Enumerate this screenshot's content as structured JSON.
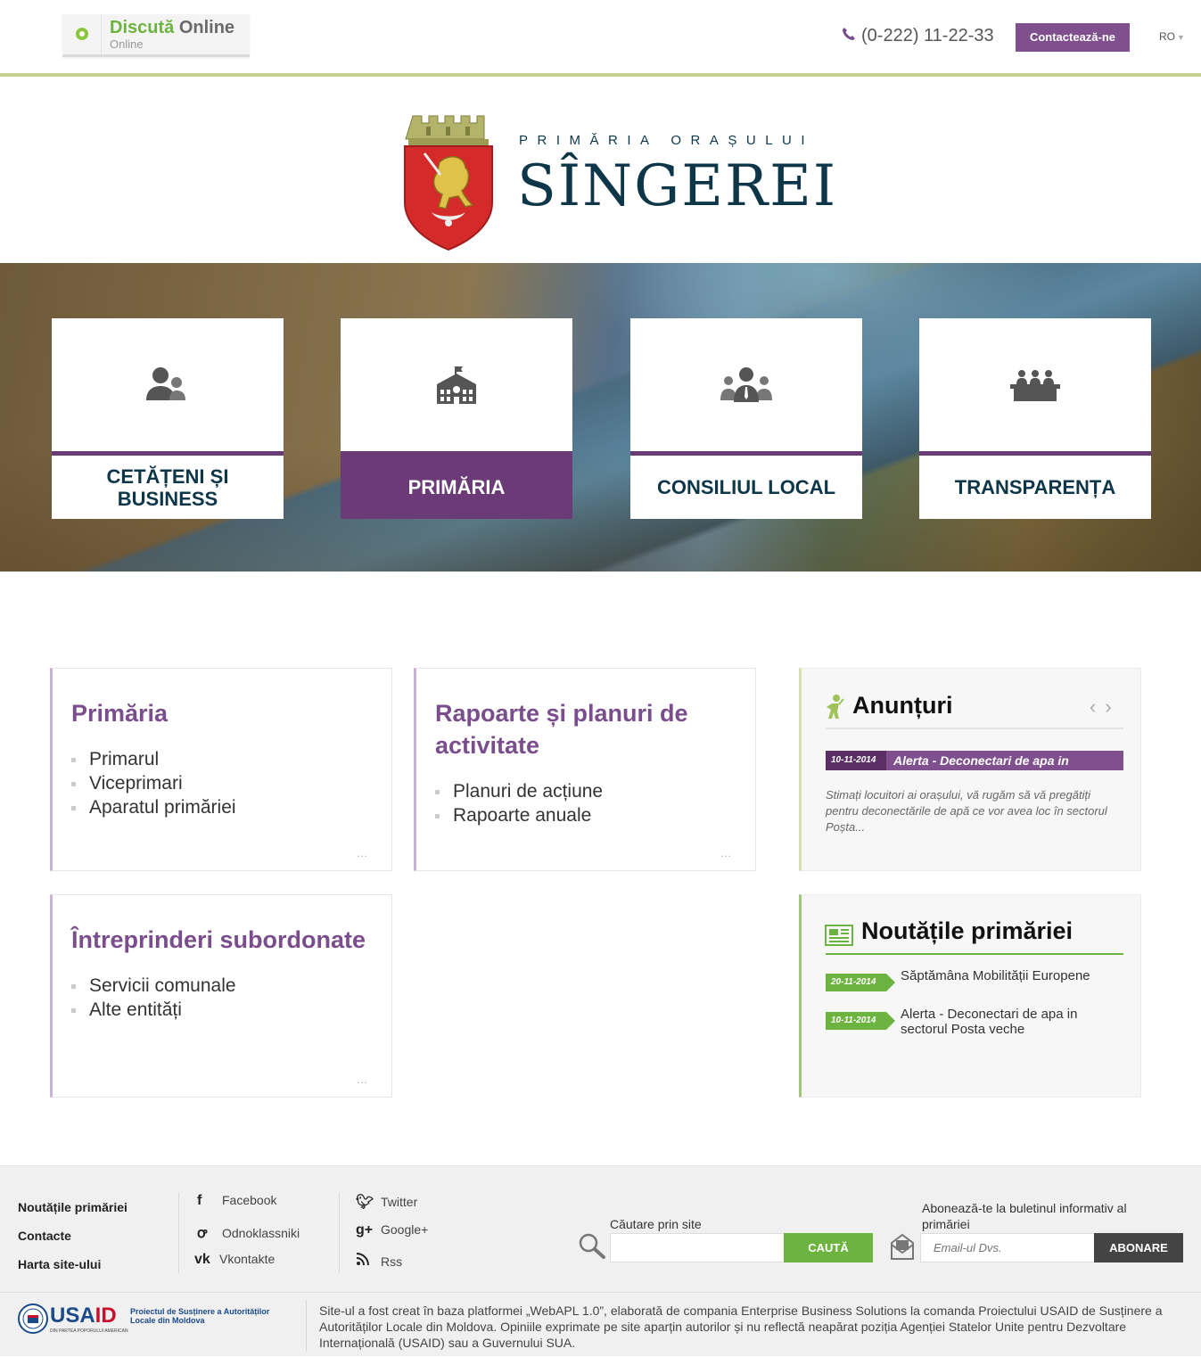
{
  "header": {
    "chat_title_green": "Discută",
    "chat_title_rest": "Online",
    "chat_status": "Online",
    "phone": "(0-222) 11-22-33",
    "contact_button": "Contactează-ne",
    "language": "RO"
  },
  "logo": {
    "subtitle": "PRIMĂRIA ORAȘULUI",
    "title": "SÎNGEREI"
  },
  "hero_tiles": [
    {
      "label": "CETĂȚENI ȘI BUSINESS",
      "icon": "citizens-icon",
      "active": false
    },
    {
      "label": "PRIMĂRIA",
      "icon": "city-hall-icon",
      "active": true
    },
    {
      "label": "CONSILIUL LOCAL",
      "icon": "council-icon",
      "active": false
    },
    {
      "label": "TRANSPARENȚA",
      "icon": "meeting-table-icon",
      "active": false
    }
  ],
  "cards": {
    "primaria": {
      "title": "Primăria",
      "items": [
        "Primarul",
        "Viceprimari",
        "Aparatul primăriei"
      ],
      "more": "..."
    },
    "rapoarte": {
      "title": "Rapoarte și planuri de activitate",
      "items": [
        "Planuri de acțiune",
        "Rapoarte anuale"
      ],
      "more": "..."
    },
    "intreprinderi": {
      "title": "Întreprinderi subordonate",
      "items": [
        "Servicii comunale",
        "Alte entități"
      ],
      "more": "..."
    }
  },
  "announcements": {
    "title": "Anunțuri",
    "prev": "‹",
    "next": "›",
    "date": "10-11-2014",
    "headline": "Alerta - Deconectari de apa in",
    "text": "Stimați locuitori ai orașului, vă rugăm să vă pregătiți pentru deconectările de apă ce vor avea loc în sectorul Poșta..."
  },
  "news": {
    "title": "Noutățile primăriei",
    "items": [
      {
        "date": "20-11-2014",
        "title": "Săptămâna Mobilității Europene"
      },
      {
        "date": "10-11-2014",
        "title": "Alerta - Deconectari de apa in sectorul Posta veche"
      }
    ]
  },
  "footer": {
    "links": [
      "Noutățile primăriei",
      "Contacte",
      "Harta site-ului"
    ],
    "social_left": [
      "Facebook",
      "Odnoklassniki",
      "Vkontakte"
    ],
    "social_right": [
      "Twitter",
      "Google+",
      "Rss"
    ],
    "search_label": "Căutare prin site",
    "search_placeholder": "",
    "search_button": "CAUTĂ",
    "subscribe_label": "Abonează-te la buletinul informativ al primăriei",
    "subscribe_placeholder": "Email-ul Dvs.",
    "subscribe_button": "ABONARE",
    "usaid_a": "USA",
    "usaid_b": "ID",
    "usaid_tagline": "DIN PARTEA POPORULUI AMERICAN",
    "usaid_project": "Proiectul de Susținere a Autorităților Locale din Moldova",
    "disclaimer": "Site-ul a fost creat în baza platformei „WebAPL 1.0”, elaborată de compania Enterprise Business Solutions la comanda Proiectului USAID de Susținere a Autorităților Locale din Moldova. Opiniile exprimate pe site aparțin autorilor și nu reflectă neapărat poziția Agenției Statelor Unite pentru Dezvoltare Internațională (USAID) sau a Guvernului SUA."
  },
  "colors": {
    "brand_purple": "#80508e",
    "tile_purple": "#6b3b78",
    "navy": "#0d3749",
    "green": "#6cb33f",
    "olive_rule": "#c6cf8f"
  }
}
